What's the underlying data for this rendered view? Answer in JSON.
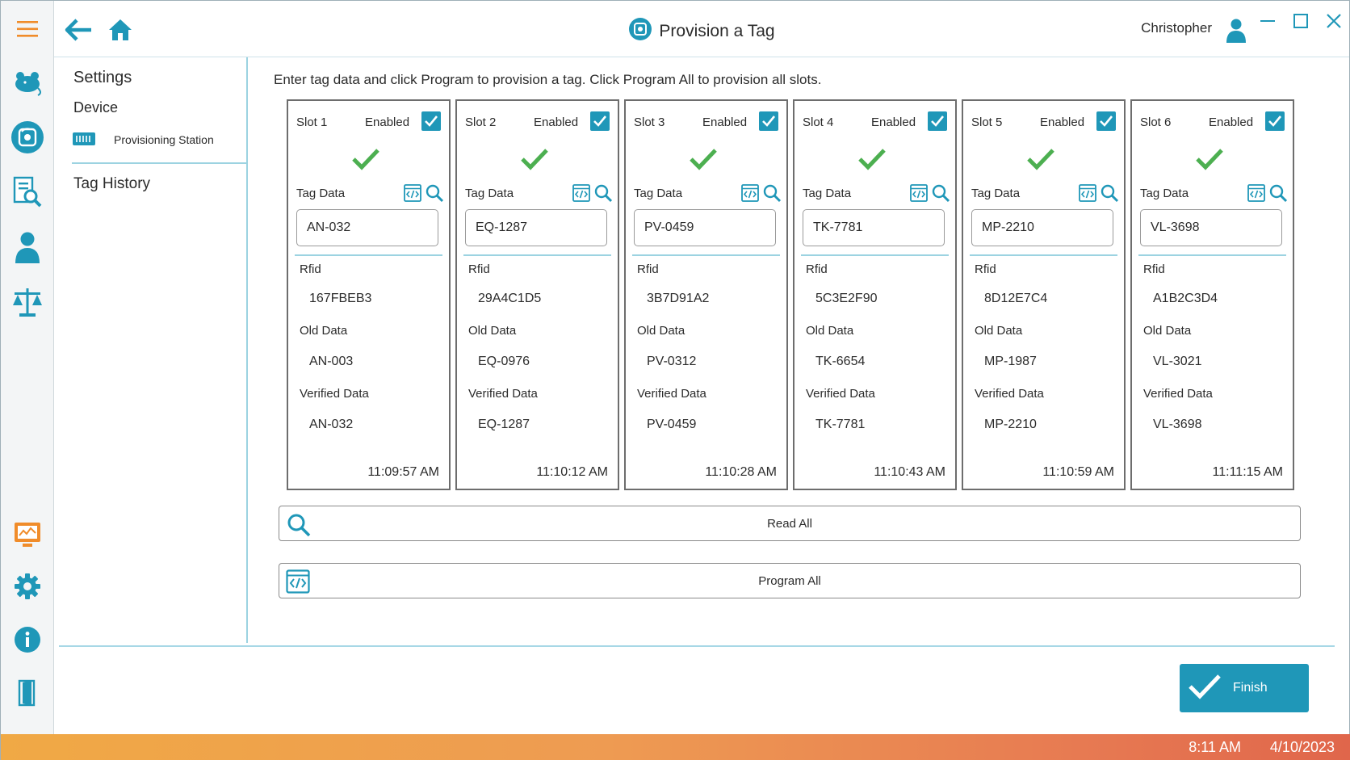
{
  "titlebar": {
    "title": "Provision a Tag",
    "user": "Christopher"
  },
  "settings": {
    "heading": "Settings",
    "device_label": "Device",
    "station_label": "Provisioning Station",
    "history_label": "Tag History"
  },
  "instructions": "Enter tag data and click Program to provision a tag. Click Program All to provision all slots.",
  "labels": {
    "enabled": "Enabled",
    "tag_data": "Tag Data",
    "rfid": "Rfid",
    "old_data": "Old Data",
    "verified_data": "Verified Data"
  },
  "slots": [
    {
      "name": "Slot 1",
      "enabled": true,
      "tag_data": "AN-032",
      "rfid": "167FBEB3",
      "old_data": "AN-003",
      "verified_data": "AN-032",
      "time": "11:09:57 AM"
    },
    {
      "name": "Slot 2",
      "enabled": true,
      "tag_data": "EQ-1287",
      "rfid": "29A4C1D5",
      "old_data": "EQ-0976",
      "verified_data": "EQ-1287",
      "time": "11:10:12 AM"
    },
    {
      "name": "Slot 3",
      "enabled": true,
      "tag_data": "PV-0459",
      "rfid": "3B7D91A2",
      "old_data": "PV-0312",
      "verified_data": "PV-0459",
      "time": "11:10:28 AM"
    },
    {
      "name": "Slot 4",
      "enabled": true,
      "tag_data": "TK-7781",
      "rfid": "5C3E2F90",
      "old_data": "TK-6654",
      "verified_data": "TK-7781",
      "time": "11:10:43 AM"
    },
    {
      "name": "Slot 5",
      "enabled": true,
      "tag_data": "MP-2210",
      "rfid": "8D12E7C4",
      "old_data": "MP-1987",
      "verified_data": "MP-2210",
      "time": "11:10:59 AM"
    },
    {
      "name": "Slot 6",
      "enabled": true,
      "tag_data": "VL-3698",
      "rfid": "A1B2C3D4",
      "old_data": "VL-3021",
      "verified_data": "VL-3698",
      "time": "11:11:15 AM"
    }
  ],
  "actions": {
    "read_all": "Read All",
    "program_all": "Program All",
    "finish": "Finish"
  },
  "status": {
    "time": "8:11 AM",
    "date": "4/10/2023"
  },
  "colors": {
    "accent": "#1f97b8",
    "success": "#4caf50",
    "orange": "#f08c2a",
    "divider": "#9cd3e1"
  },
  "icons": {
    "rail": [
      "menu-icon",
      "mouse-icon",
      "tag-icon",
      "report-search-icon",
      "user-icon",
      "scale-icon",
      "monitor-icon",
      "gear-icon",
      "info-icon",
      "exit-door-icon"
    ],
    "slot": [
      "checkbox-icon",
      "success-check-icon",
      "code-icon",
      "search-icon"
    ]
  }
}
